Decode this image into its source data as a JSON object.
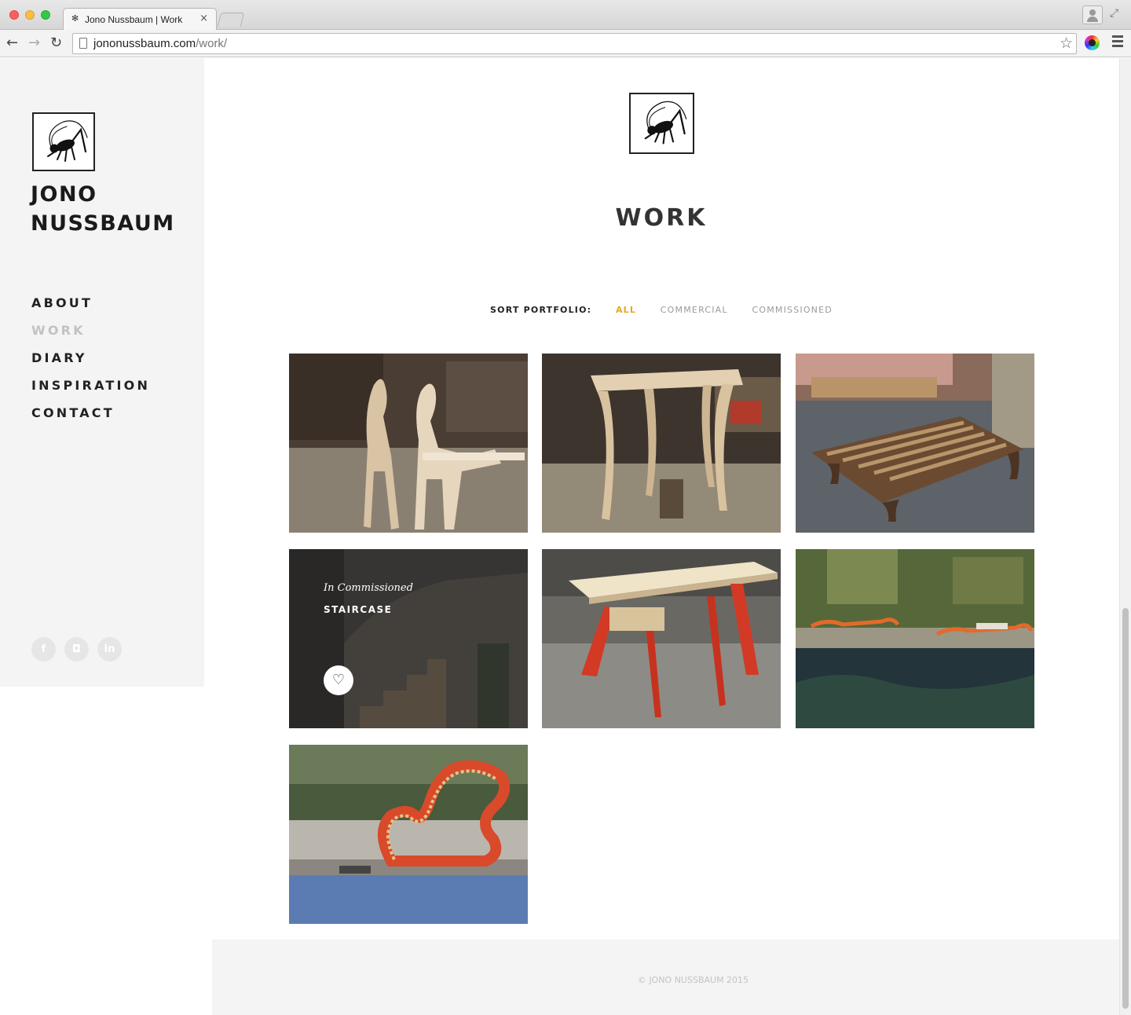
{
  "browser": {
    "tab_title": "Jono Nussbaum | Work",
    "tab_close": "×",
    "url_domain": "jononussbaum.com",
    "url_path": "/work/",
    "icons": [
      "back-arrow-icon",
      "forward-arrow-icon",
      "reload-icon",
      "page-icon",
      "bookmark-star-icon",
      "extension-icon",
      "menu-icon",
      "profile-icon",
      "fullscreen-icon"
    ]
  },
  "sidebar": {
    "brand_line1": "JONO",
    "brand_line2": "NUSSBAUM",
    "nav": [
      {
        "label": "ABOUT",
        "active": false
      },
      {
        "label": "WORK",
        "active": true
      },
      {
        "label": "DIARY",
        "active": false
      },
      {
        "label": "INSPIRATION",
        "active": false
      },
      {
        "label": "CONTACT",
        "active": false
      }
    ],
    "socials": [
      {
        "icon": "facebook-icon",
        "glyph": "f"
      },
      {
        "icon": "instagram-icon",
        "glyph": "◘"
      },
      {
        "icon": "linkedin-icon",
        "glyph": "in"
      }
    ]
  },
  "main": {
    "title": "WORK",
    "sort_label": "SORT PORTFOLIO:",
    "sort_options": [
      "ALL",
      "COMMERCIAL",
      "COMMISSIONED"
    ],
    "sort_active": "ALL",
    "accent_color": "#e3a821",
    "portfolio": [
      {
        "name": "rocking-horses-image"
      },
      {
        "name": "console-table-image"
      },
      {
        "name": "slatted-bench-image"
      },
      {
        "name": "staircase-image",
        "category": "In Commissioned",
        "title": "STAIRCASE",
        "like_glyph": "♡"
      },
      {
        "name": "red-leg-table-image"
      },
      {
        "name": "poolside-loungers-image"
      },
      {
        "name": "red-curved-chair-image"
      }
    ]
  },
  "footer": {
    "copyright": "© JONO NUSSBAUM 2015"
  }
}
